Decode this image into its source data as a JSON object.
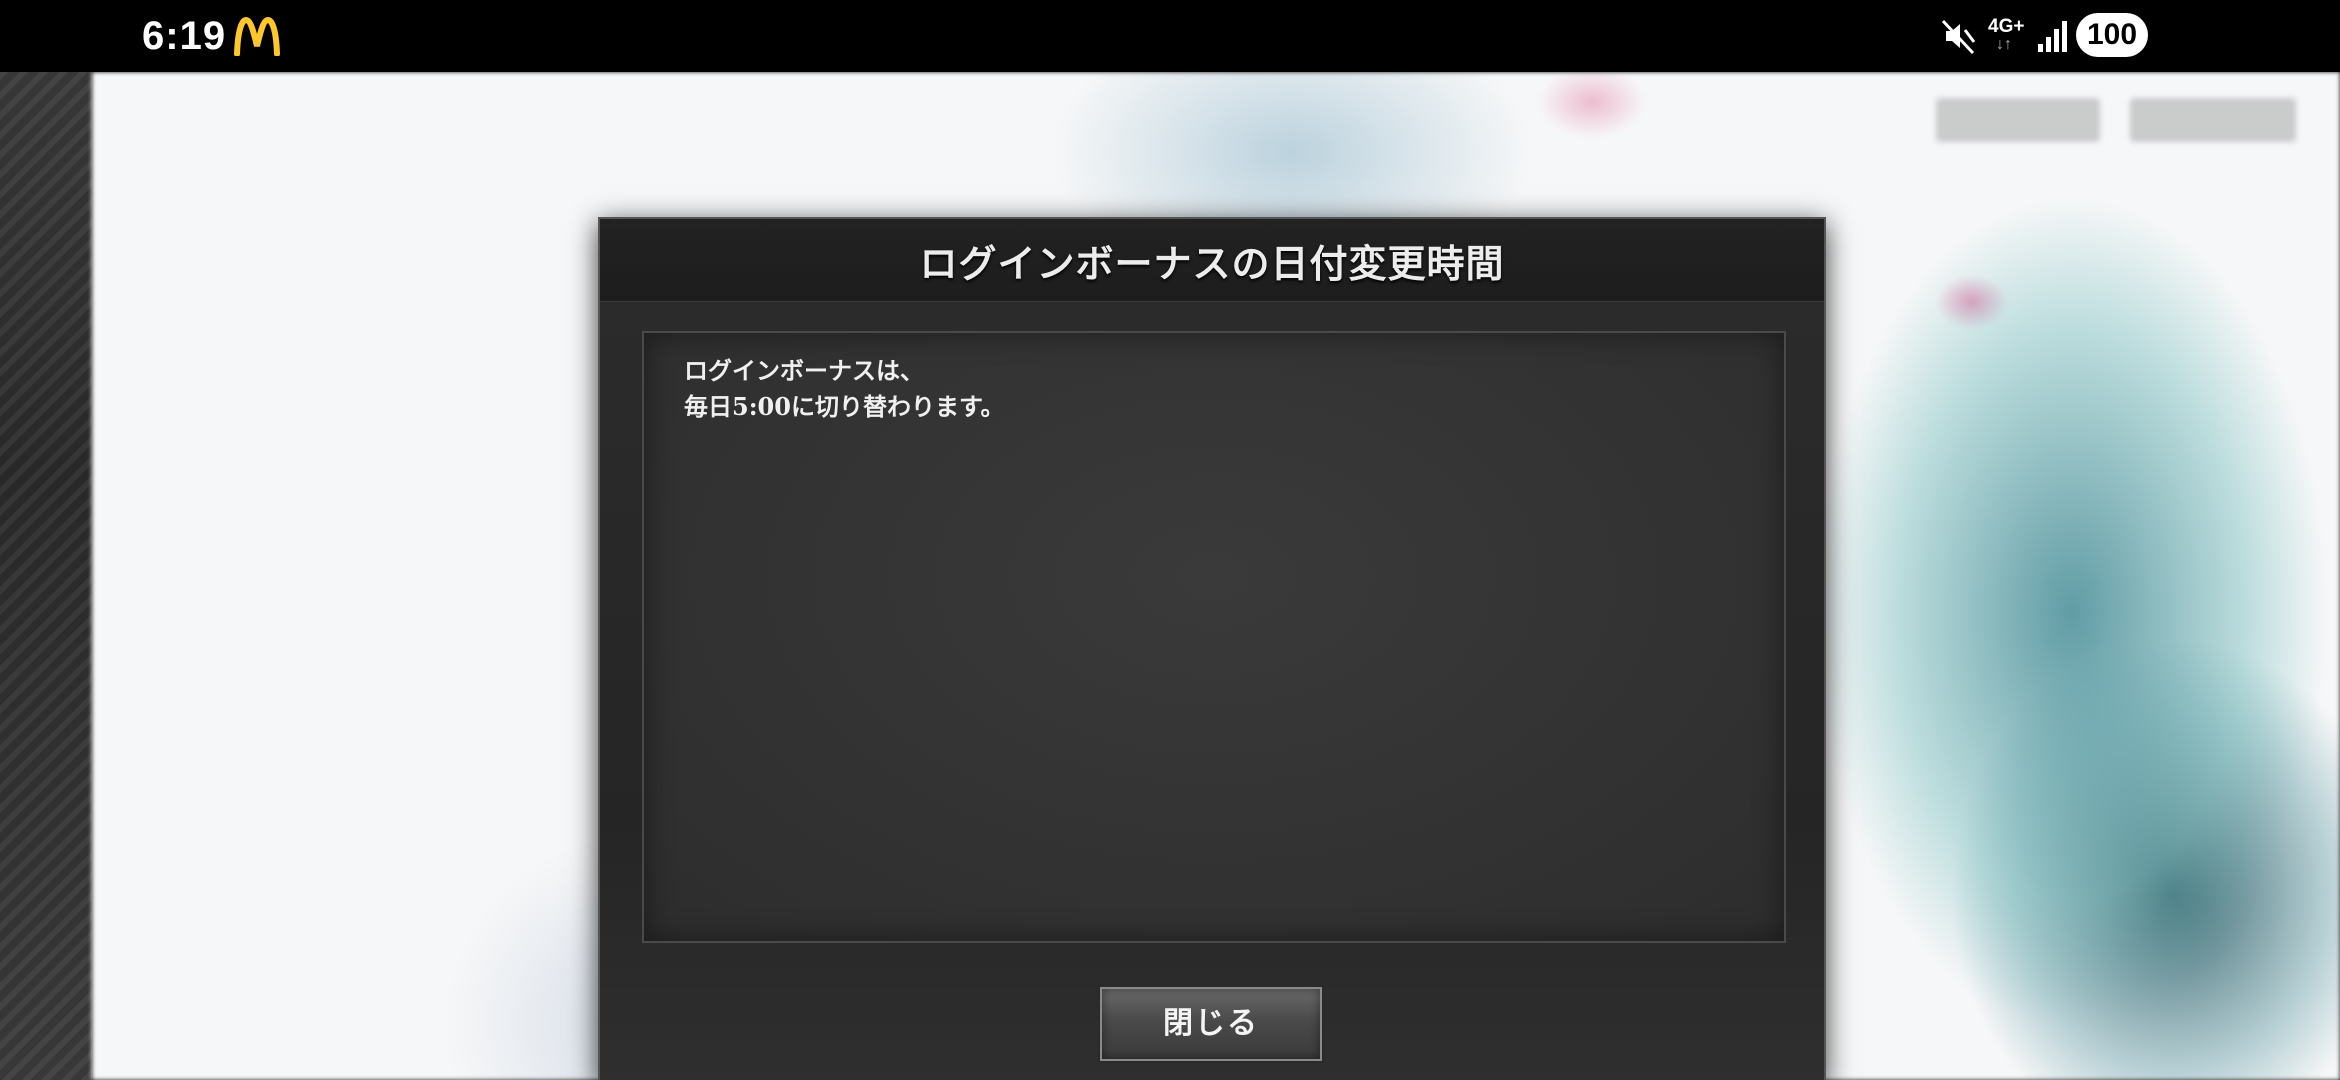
{
  "status_bar": {
    "time": "6:19",
    "network": "4G+",
    "battery": "100",
    "icons": [
      "mcdonalds-app-icon",
      "mute-icon",
      "network-4g-icon",
      "signal-icon",
      "battery-icon"
    ]
  },
  "dialog": {
    "title": "ログインボーナスの日付変更時間",
    "message": "ログインボーナスは、\n毎日5:00に切り替わります。",
    "close_label": "閉じる"
  },
  "colors": {
    "dialog_bg": "#2c2c2c",
    "panel_bg": "#353535",
    "text": "#f0f0f0",
    "mcd_yellow": "#ffc72c"
  }
}
